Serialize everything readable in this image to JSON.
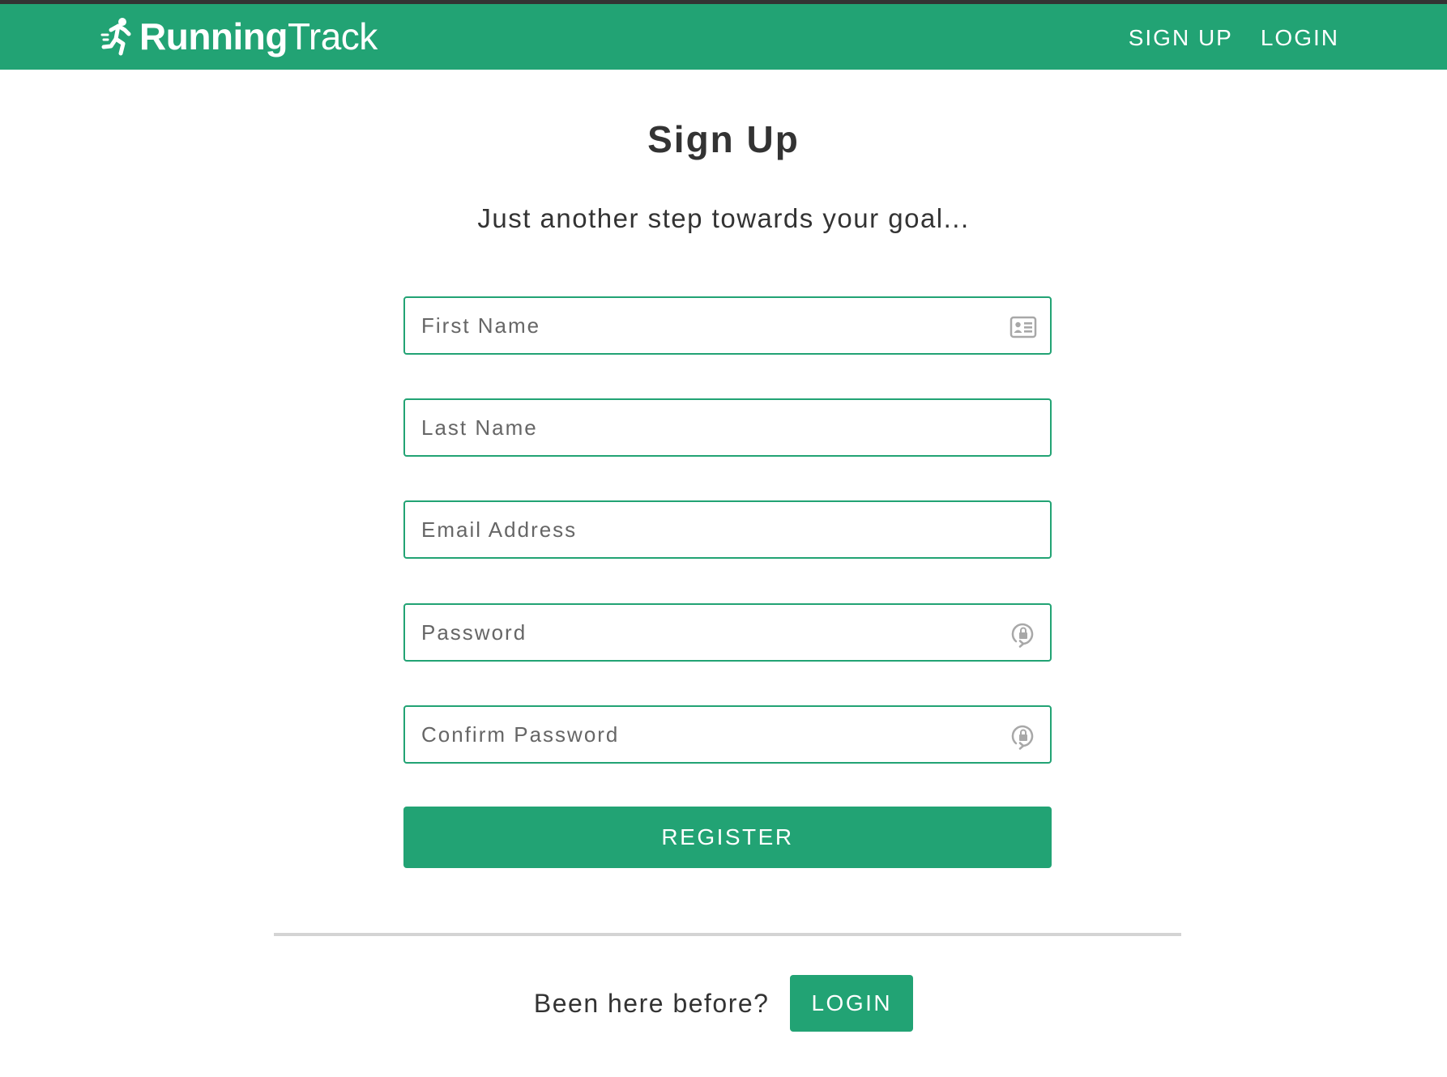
{
  "colors": {
    "brand_green": "#22a374",
    "text_dark": "#333333",
    "placeholder": "#666666",
    "icon_gray": "#a8a8a8",
    "divider": "#d4d4d4"
  },
  "navbar": {
    "brand_icon": "running-person-icon",
    "brand_bold": "Running",
    "brand_regular": "Track",
    "links": [
      {
        "label": "SIGN UP"
      },
      {
        "label": "LOGIN"
      }
    ]
  },
  "page": {
    "title": "Sign Up",
    "subtitle": "Just another step towards your goal..."
  },
  "form": {
    "fields": [
      {
        "placeholder": "First Name",
        "value": "",
        "icon": "id-card-icon"
      },
      {
        "placeholder": "Last Name",
        "value": "",
        "icon": ""
      },
      {
        "placeholder": "Email Address",
        "value": "",
        "icon": ""
      },
      {
        "placeholder": "Password",
        "value": "",
        "icon": "lock-reset-icon"
      },
      {
        "placeholder": "Confirm Password",
        "value": "",
        "icon": "lock-reset-icon"
      }
    ],
    "submit_label": "REGISTER"
  },
  "footer": {
    "prompt": "Been here before?",
    "login_label": "LOGIN"
  }
}
